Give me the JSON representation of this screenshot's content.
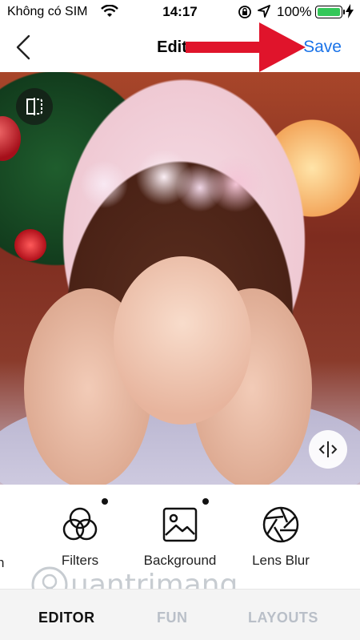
{
  "status_bar": {
    "carrier": "Không có SIM",
    "time": "14:17",
    "battery_percent": "100%"
  },
  "nav": {
    "title": "Editor",
    "save_label": "Save",
    "accent_color": "#1a73e8"
  },
  "tools": {
    "partial_left": "h",
    "partial_right": "",
    "items": [
      {
        "label": "Filters",
        "icon": "filters-icon"
      },
      {
        "label": "Background",
        "icon": "image-icon"
      },
      {
        "label": "Lens Blur",
        "icon": "aperture-icon"
      }
    ]
  },
  "tabs": [
    {
      "label": "EDITOR",
      "active": true
    },
    {
      "label": "FUN",
      "active": false
    },
    {
      "label": "LAYOUTS",
      "active": false
    }
  ],
  "watermark": {
    "text": "uantrimang"
  }
}
